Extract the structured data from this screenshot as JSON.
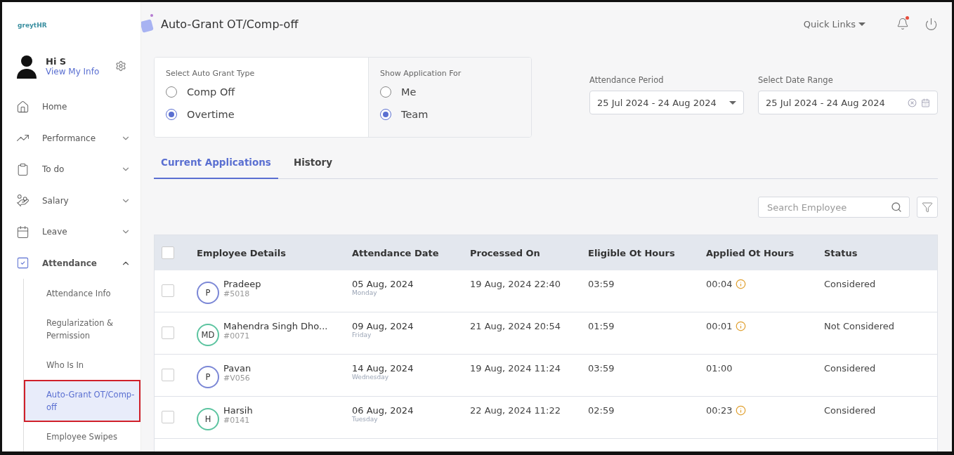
{
  "sidebar": {
    "logo": "greytHR",
    "user": {
      "greeting": "Hi S",
      "link": "View My Info"
    },
    "items": [
      {
        "label": "Home"
      },
      {
        "label": "Performance",
        "expanded": false
      },
      {
        "label": "To do",
        "expanded": false
      },
      {
        "label": "Salary",
        "expanded": false
      },
      {
        "label": "Leave",
        "expanded": false
      },
      {
        "label": "Attendance",
        "expanded": true,
        "children": [
          {
            "label": "Attendance Info",
            "selected": false
          },
          {
            "label": "Regularization & Permission",
            "selected": false
          },
          {
            "label": "Who Is In",
            "selected": false
          },
          {
            "label": "Auto-Grant OT/Comp-off",
            "selected": true
          },
          {
            "label": "Employee Swipes",
            "selected": false
          }
        ]
      }
    ]
  },
  "header": {
    "title": "Auto-Grant OT/Comp-off",
    "quick_links": "Quick Links",
    "notification": true
  },
  "filters": {
    "grant_type": {
      "label": "Select Auto Grant Type",
      "options": [
        {
          "label": "Comp Off",
          "selected": false
        },
        {
          "label": "Overtime",
          "selected": true
        }
      ]
    },
    "show_for": {
      "label": "Show Application For",
      "options": [
        {
          "label": "Me",
          "selected": false
        },
        {
          "label": "Team",
          "selected": true
        }
      ]
    },
    "attendance_period": {
      "label": "Attendance Period",
      "value": "25 Jul 2024 - 24 Aug 2024"
    },
    "date_range": {
      "label": "Select Date Range",
      "value": "25 Jul 2024 - 24 Aug 2024"
    }
  },
  "tabs": [
    {
      "label": "Current Applications",
      "selected": true
    },
    {
      "label": "History",
      "selected": false
    }
  ],
  "search": {
    "placeholder": "Search Employee"
  },
  "table": {
    "select_all": {
      "checked": false
    },
    "columns": [
      "Employee Details",
      "Attendance Date",
      "Processed On",
      "Eligible Ot Hours",
      "Applied Ot Hours",
      "Status"
    ],
    "rows": [
      {
        "initials": "P",
        "color": "#7b87d6",
        "name": "Pradeep",
        "id": "#5018",
        "date": "05 Aug, 2024",
        "day": "Monday",
        "processed": "19 Aug, 2024 22:40",
        "eligible": "03:59",
        "applied": "00:04",
        "info": true,
        "status": "Considered",
        "checked": false
      },
      {
        "initials": "MD",
        "color": "#5cc4a0",
        "name": "Mahendra Singh Dho...",
        "id": "#0071",
        "date": "09 Aug, 2024",
        "day": "Friday",
        "processed": "21 Aug, 2024 20:54",
        "eligible": "01:59",
        "applied": "00:01",
        "info": true,
        "status": "Not Considered",
        "checked": false
      },
      {
        "initials": "P",
        "color": "#7b87d6",
        "name": "Pavan",
        "id": "#V056",
        "date": "14 Aug, 2024",
        "day": "Wednesday",
        "processed": "19 Aug, 2024 11:24",
        "eligible": "03:59",
        "applied": "01:00",
        "info": false,
        "status": "Considered",
        "checked": false
      },
      {
        "initials": "H",
        "color": "#5cc4a0",
        "name": "Harsih",
        "id": "#0141",
        "date": "06 Aug, 2024",
        "day": "Tuesday",
        "processed": "22 Aug, 2024 11:22",
        "eligible": "02:59",
        "applied": "00:23",
        "info": true,
        "status": "Considered",
        "checked": false
      }
    ]
  }
}
